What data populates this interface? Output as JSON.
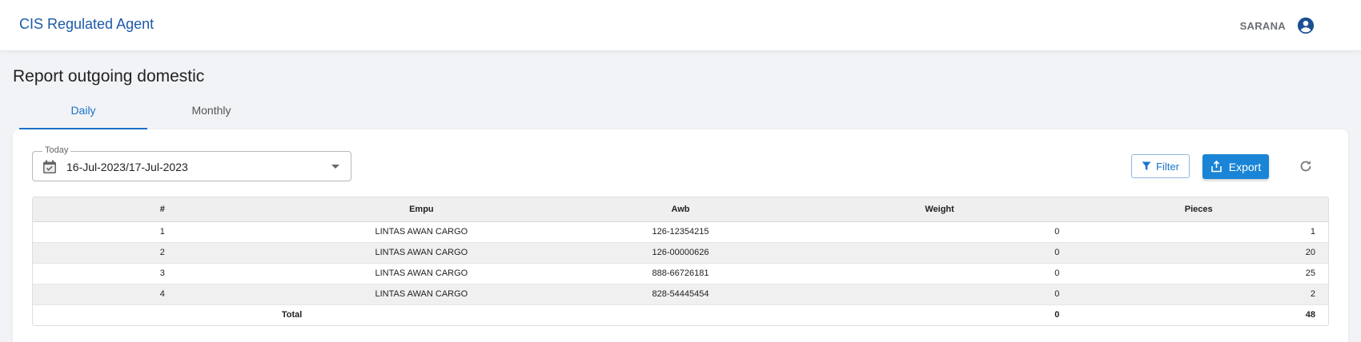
{
  "header": {
    "app_title": "CIS Regulated Agent",
    "user_name": "SARANA",
    "user_icon": "account-circle-icon"
  },
  "page": {
    "title": "Report outgoing domestic"
  },
  "tabs": [
    {
      "label": "Daily",
      "active": true
    },
    {
      "label": "Monthly",
      "active": false
    }
  ],
  "date_range": {
    "label": "Today",
    "value": "16-Jul-2023/17-Jul-2023"
  },
  "toolbar": {
    "filter_label": "Filter",
    "export_label": "Export"
  },
  "table": {
    "columns": [
      "#",
      "Empu",
      "Awb",
      "Weight",
      "Pieces"
    ],
    "rows": [
      {
        "no": "1",
        "empu": "LINTAS AWAN CARGO",
        "awb": "126-12354215",
        "weight": "0",
        "pieces": "1"
      },
      {
        "no": "2",
        "empu": "LINTAS AWAN CARGO",
        "awb": "126-00000626",
        "weight": "0",
        "pieces": "20"
      },
      {
        "no": "3",
        "empu": "LINTAS AWAN CARGO",
        "awb": "888-66726181",
        "weight": "0",
        "pieces": "25"
      },
      {
        "no": "4",
        "empu": "LINTAS AWAN CARGO",
        "awb": "828-54445454",
        "weight": "0",
        "pieces": "2"
      }
    ],
    "total": {
      "label": "Total",
      "weight": "0",
      "pieces": "48"
    }
  },
  "colors": {
    "brand": "#1c5aa6",
    "accent": "#1a84d6"
  }
}
